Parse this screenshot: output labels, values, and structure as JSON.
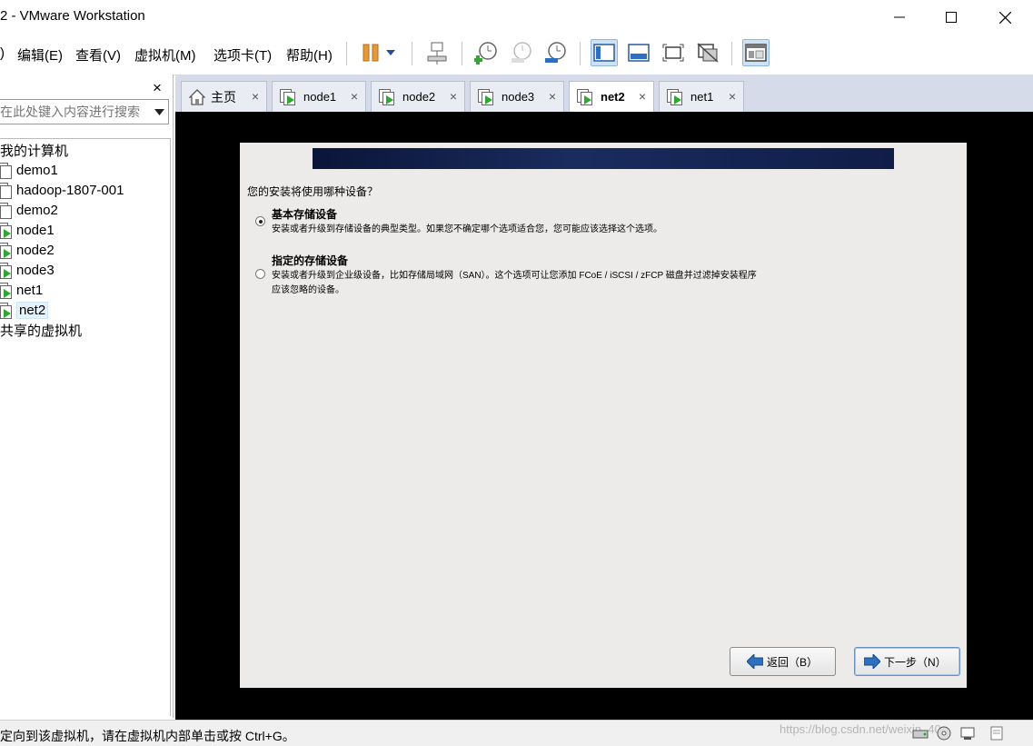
{
  "window": {
    "title": "2 - VMware Workstation",
    "controls": {
      "minimize": "—",
      "maximize": "☐",
      "close": "✕"
    }
  },
  "menu": {
    "items": [
      ")",
      "编辑(E)",
      "查看(V)",
      "虚拟机(M)",
      "选项卡(T)",
      "帮助(H)"
    ]
  },
  "toolbar": {
    "buttons": [
      "pause-icon",
      "dropdown-icon",
      "network-icon",
      "snapshot-take-icon",
      "snapshot-revert-icon",
      "snapshot-manager-icon",
      "console-view-icon",
      "fit-guest-icon",
      "full-screen-icon",
      "unity-icon",
      "library-view-icon"
    ]
  },
  "library": {
    "close": "×",
    "search_placeholder": "在此处键入内容进行搜索",
    "root": "我的计算机",
    "vms": [
      "demo1",
      "hadoop-1807-001",
      "demo2",
      "node1",
      "node2",
      "node3",
      "net1",
      "net2"
    ],
    "selected": "net2",
    "shared": "共享的虚拟机"
  },
  "tabs": {
    "home": "主页",
    "items": [
      "node1",
      "node2",
      "node3",
      "net2",
      "net1"
    ],
    "active": "net2",
    "close": "×"
  },
  "installer": {
    "question": "您的安装将使用哪种设备？",
    "option1": {
      "title": "基本存储设备",
      "desc": "安装或者升级到存储设备的典型类型。如果您不确定哪个选项适合您，您可能应该选择这个选项。",
      "checked": true
    },
    "option2": {
      "title": "指定的存储设备",
      "desc1": "安装或者升级到企业级设备，比如存储局域网（SAN）。这个选项可让您添加 FCoE / iSCSI / zFCP 磁盘并过滤掉安装程序",
      "desc2": "应该忽略的设备。",
      "checked": false
    },
    "back_button": "返回（B）",
    "next_button": "下一步（N）"
  },
  "status": {
    "text": "定向到该虚拟机，请在虚拟机内部单击或按 Ctrl+G。",
    "watermark": "https://blog.csdn.net/weixin_40..."
  },
  "colors": {
    "tab_strip": "#d6dbe9",
    "installer_bg": "#ecebe9",
    "banner": "#1a2c5e",
    "arrow_blue": "#2f6fbf",
    "vm_green": "#2ea82e"
  }
}
